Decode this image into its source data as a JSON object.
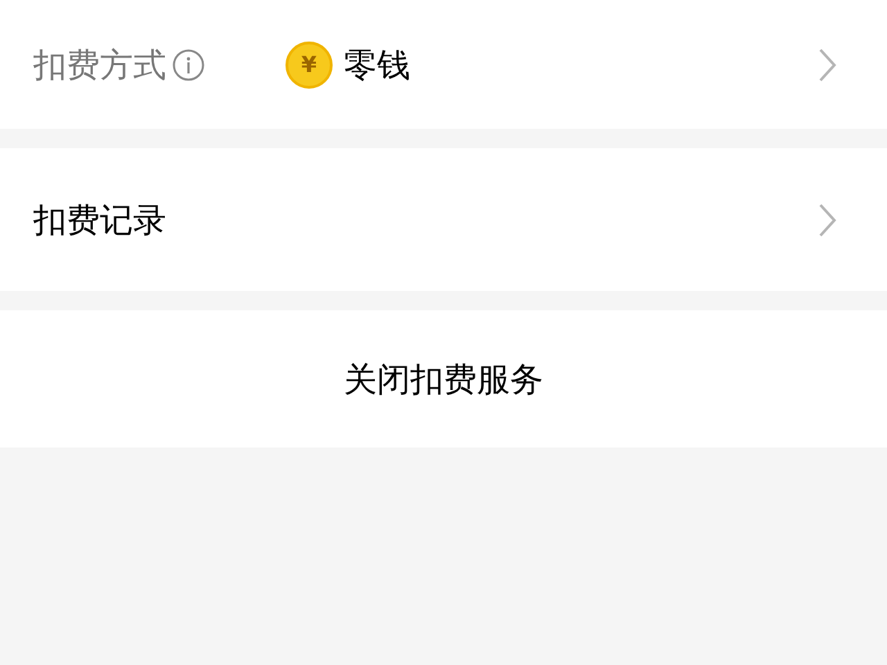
{
  "payment_method": {
    "label": "扣费方式",
    "value": "零钱",
    "coin": "¥"
  },
  "deduction_records": {
    "label": "扣费记录"
  },
  "close_service": {
    "label": "关闭扣费服务"
  }
}
